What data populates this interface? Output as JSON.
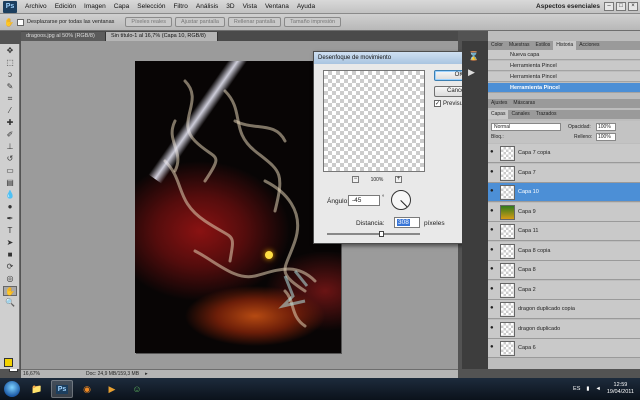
{
  "menubar": {
    "logo": "Ps",
    "items": [
      "Archivo",
      "Edición",
      "Imagen",
      "Capa",
      "Selección",
      "Filtro",
      "Análisis",
      "3D",
      "Vista",
      "Ventana",
      "Ayuda"
    ],
    "workspace": "Aspectos esenciales"
  },
  "options": {
    "checkbox_label": "Desplazarse por todas las ventanas",
    "buttons": [
      "Píxeles reales",
      "Ajustar pantalla",
      "Rellenar pantalla",
      "Tamaño impresión"
    ]
  },
  "tabs": [
    {
      "label": "dragoos.jpg al 50% (RGB/8)"
    },
    {
      "label": "Sin título-1 al 16,7% (Capa 10, RGB/8)"
    }
  ],
  "status": {
    "zoom": "16,67%",
    "doc": "Doc: 24,9 MB/159,3 MB"
  },
  "dialog": {
    "title": "Desenfoque de movimiento",
    "ok": "OK",
    "cancel": "Cancelar",
    "preview_label": "Previsualizar",
    "zoom": "100%",
    "angle_label": "Ángulo:",
    "angle_value": "-45",
    "angle_unit": "°",
    "distance_label": "Distancia:",
    "distance_value": "308",
    "distance_unit": "píxeles"
  },
  "history": {
    "tabs": [
      "Color",
      "Muestras",
      "Estilos",
      "Historia",
      "Acciones"
    ],
    "items": [
      {
        "label": "Nueva capa"
      },
      {
        "label": "Herramienta Pincel"
      },
      {
        "label": "Herramienta Pincel"
      },
      {
        "label": "Herramienta Pincel"
      }
    ]
  },
  "layers": {
    "tabs_top": [
      "Ajustes",
      "Máscaras"
    ],
    "tabs": [
      "Capas",
      "Canales",
      "Trazados"
    ],
    "blend_mode": "Normal",
    "opacity_label": "Opacidad:",
    "opacity_value": "100%",
    "lock_label": "Bloq.:",
    "fill_label": "Relleno:",
    "fill_value": "100%",
    "items": [
      {
        "name": "Capa 7 copia"
      },
      {
        "name": "Capa 7"
      },
      {
        "name": "Capa 10"
      },
      {
        "name": "Capa 9"
      },
      {
        "name": "Capa 11"
      },
      {
        "name": "Capa 8 copia"
      },
      {
        "name": "Capa 8"
      },
      {
        "name": "Capa 2"
      },
      {
        "name": "dragon duplicado copia"
      },
      {
        "name": "dragon duplicado"
      },
      {
        "name": "Capa 6"
      }
    ]
  },
  "taskbar": {
    "lang": "ES",
    "time": "12:59",
    "date": "19/04/2011"
  },
  "colors": {
    "accent": "#4c8fd6",
    "foreground": "#f3d200",
    "background": "#ffffff"
  }
}
